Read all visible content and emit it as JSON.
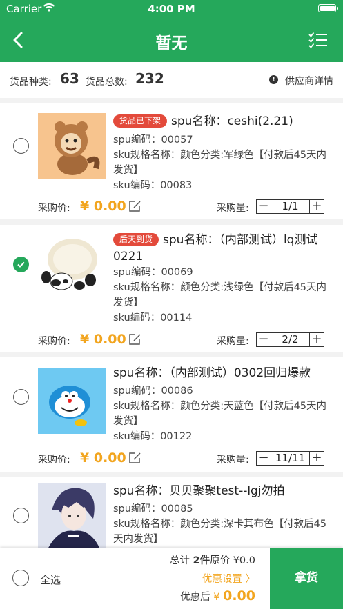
{
  "status_bar": {
    "carrier": "Carrier",
    "time": "4:00 PM"
  },
  "nav": {
    "title": "暂无"
  },
  "summary": {
    "kinds_label": "货品种类:",
    "kinds_value": "63",
    "total_label": "货品总数:",
    "total_value": "232",
    "supplier_link": "供应商详情"
  },
  "item_labels": {
    "price_label": "采购价:",
    "qty_label": "采购量:",
    "currency": "¥"
  },
  "products": [
    {
      "tag": "货品已下架",
      "name": "spu名称：ceshi(2.21)",
      "spu_code": "spu编码：00057",
      "sku_spec": "sku规格名称：颜色分类:军绿色【付款后45天内发货】",
      "sku_code": "sku编码：00083",
      "price": "0.00",
      "qty": "1/1",
      "checked": false
    },
    {
      "tag": "后天到货",
      "name": "spu名称：（内部测试）lq测试0221",
      "spu_code": "spu编码：00069",
      "sku_spec": "sku规格名称：颜色分类:浅绿色【付款后45天内发货】",
      "sku_code": "sku编码：00114",
      "price": "0.00",
      "qty": "2/2",
      "checked": true
    },
    {
      "tag": "",
      "name": "spu名称：（内部测试）0302回归爆款",
      "spu_code": "spu编码：00086",
      "sku_spec": "sku规格名称：颜色分类:天蓝色【付款后45天内发货】",
      "sku_code": "sku编码：00122",
      "price": "0.00",
      "qty": "11/11",
      "checked": false
    },
    {
      "tag": "",
      "name": "spu名称：贝贝聚聚test--lgj勿拍",
      "spu_code": "spu编码：00085",
      "sku_spec": "sku规格名称：颜色分类:深卡其布色【付款后45天内发货】",
      "checked": false
    }
  ],
  "bottom": {
    "select_all": "全选",
    "total_prefix": "总计 ",
    "total_count": "2件",
    "total_suffix": "原价 ¥0.0",
    "discount_link": "优惠设置 〉",
    "after_label": "优惠后",
    "after_currency": "¥",
    "after_amount": "0.00",
    "submit": "拿货"
  },
  "colors": {
    "brand": "#25a85b",
    "price": "#f2a51f",
    "tag": "#e34a3b"
  }
}
